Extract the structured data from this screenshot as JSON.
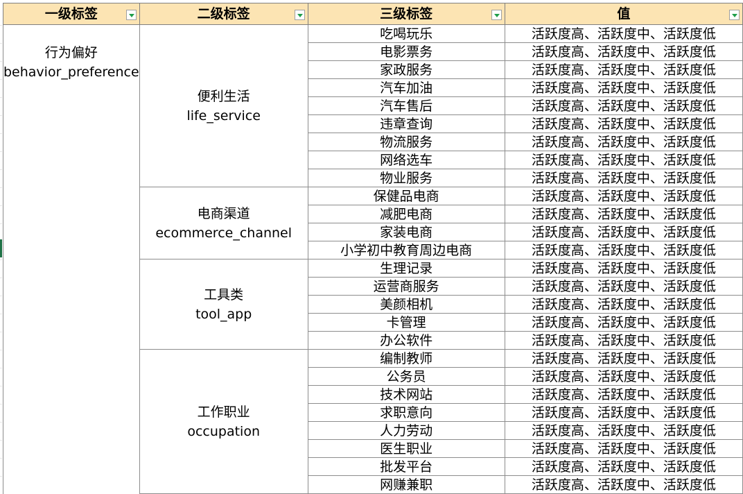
{
  "headers": [
    {
      "label": "一级标签"
    },
    {
      "label": "二级标签"
    },
    {
      "label": "三级标签"
    },
    {
      "label": "值"
    }
  ],
  "level1": {
    "cn": "行为偏好",
    "en": "behavior_preference"
  },
  "groups": [
    {
      "cn": "便利生活",
      "en": "life_service",
      "items": [
        "吃喝玩乐",
        "电影票务",
        "家政服务",
        "汽车加油",
        "汽车售后",
        "违章查询",
        "物流服务",
        "网络选车",
        "物业服务"
      ]
    },
    {
      "cn": "电商渠道",
      "en": "ecommerce_channel",
      "items": [
        "保健品电商",
        "减肥电商",
        "家装电商",
        "小学初中教育周边电商"
      ]
    },
    {
      "cn": "工具类",
      "en": "tool_app",
      "items": [
        "生理记录",
        "运营商服务",
        "美颜相机",
        "卡管理",
        "办公软件"
      ]
    },
    {
      "cn": "工作职业",
      "en": "occupation",
      "items": [
        "编制教师",
        "公务员",
        "技术网站",
        "求职意向",
        "人力劳动",
        "医生职业",
        "批发平台",
        "网赚兼职"
      ]
    }
  ],
  "value_text": "活跃度高、活跃度中、活跃度低",
  "colors": {
    "header_bg": "#fce4b3",
    "filter_arrow": "#1f9e4a",
    "active_row_marker": "#1e7145"
  }
}
